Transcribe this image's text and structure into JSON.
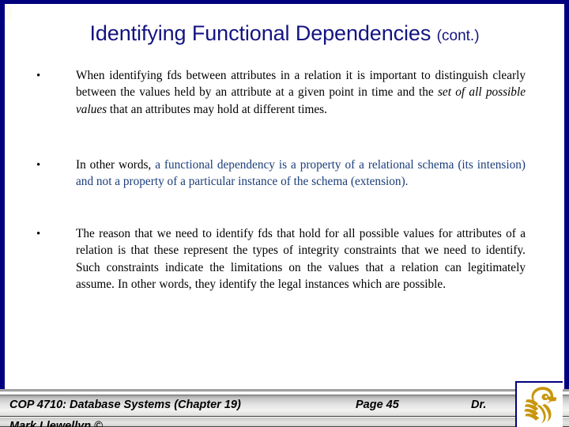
{
  "slide": {
    "title_main": "Identifying Functional Dependencies",
    "title_cont": "(cont.)",
    "bullet_marker": "•",
    "accent_navy": "#00007e",
    "text_navy": "#1b3d7a",
    "logo_gold": "#c8960c",
    "background": "#ffffff"
  },
  "bullets": [
    {
      "marker": "•",
      "segments": [
        {
          "text": "When identifying fds between attributes in a relation it is important to distinguish clearly between the values held by an attribute at a given point in time and the ",
          "style": "normal",
          "color": "black"
        },
        {
          "text": "set of all possible values",
          "style": "italic",
          "color": "black"
        },
        {
          "text": " that an attributes may hold at different times.",
          "style": "normal",
          "color": "black"
        }
      ]
    },
    {
      "marker": "•",
      "segments": [
        {
          "text": "In other words, ",
          "style": "normal",
          "color": "black"
        },
        {
          "text": "a functional dependency is a property of a relational schema (its intension) and not a property of a particular instance of the schema (extension).",
          "style": "normal",
          "color": "navy"
        }
      ]
    },
    {
      "marker": "•",
      "segments": [
        {
          "text": "The reason that we need to identify fds that hold for all possible values for attributes of a relation is that these represent the types of integrity constraints that we need to identify.  Such constraints indicate the limitations on the values that a relation can legitimately assume.  In other words, they identify the legal instances which are possible.",
          "style": "normal",
          "color": "black"
        }
      ]
    }
  ],
  "footer": {
    "course": "COP 4710: Database Systems  (Chapter 19)",
    "page": "Page 45",
    "instructor_prefix": "Dr.",
    "author": "Mark Llewellyn ©",
    "logo_name": "ucf-pegasus-logo"
  }
}
